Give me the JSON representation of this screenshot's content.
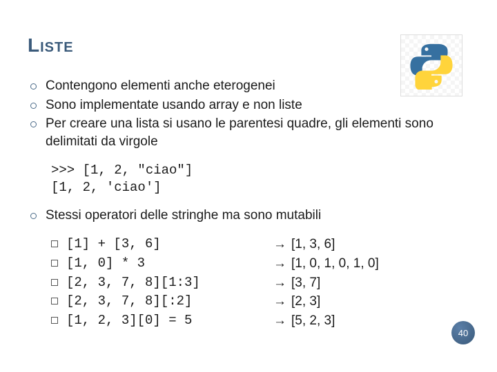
{
  "title": "Liste",
  "bullets_top": [
    "Contengono elementi anche eterogenei",
    "Sono implementate usando array e non liste",
    "Per creare una lista si usano le parentesi quadre, gli elementi sono delimitati da virgole"
  ],
  "code_example": ">>> [1, 2, \"ciao\"]\n[1, 2, 'ciao']",
  "bullet_mid": "Stessi operatori delle stringhe ma sono mutabili",
  "examples": [
    {
      "expr": "[1] + [3, 6]",
      "result": "[1, 3, 6]"
    },
    {
      "expr": "[1, 0] * 3",
      "result": "[1, 0, 1, 0, 1, 0]"
    },
    {
      "expr": "[2, 3, 7, 8][1:3]",
      "result": "[3, 7]"
    },
    {
      "expr": "[2, 3, 7, 8][:2]",
      "result": "[2, 3]"
    },
    {
      "expr": "[1, 2, 3][0] = 5",
      "result": "[5, 2, 3]"
    }
  ],
  "arrow": "→",
  "page_number": "40"
}
